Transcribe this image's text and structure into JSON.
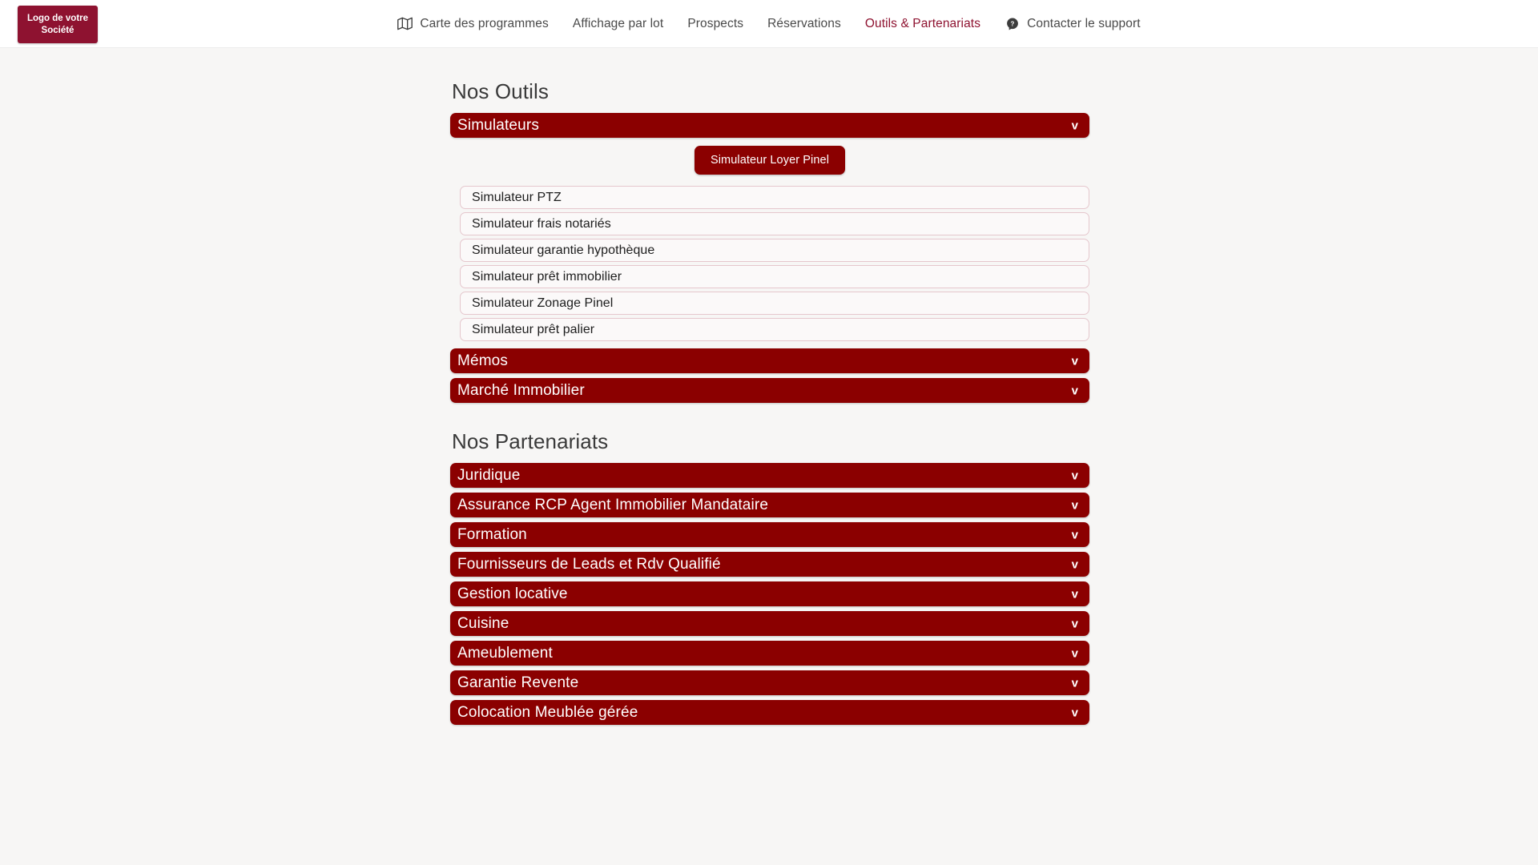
{
  "topbar": {
    "logo": {
      "line1": "Logo de votre",
      "line2": "Société"
    },
    "nav_items": [
      {
        "label": "Carte des programmes",
        "icon": "map-icon",
        "active": false
      },
      {
        "label": "Affichage par lot",
        "icon": null,
        "active": false
      },
      {
        "label": "Prospects",
        "icon": null,
        "active": false
      },
      {
        "label": "Réservations",
        "icon": null,
        "active": false
      },
      {
        "label": "Outils & Partenariats",
        "icon": null,
        "active": true
      },
      {
        "label": "Contacter le support",
        "icon": "help-circle-icon",
        "active": false
      }
    ]
  },
  "sections": [
    {
      "title": "Nos Outils",
      "groups": [
        {
          "label": "Simulateurs",
          "chevron": "v",
          "expanded": true,
          "featured_button": "Simulateur Loyer Pinel",
          "options": [
            "Simulateur PTZ",
            "Simulateur frais notariés",
            "Simulateur garantie hypothèque",
            "Simulateur prêt immobilier",
            "Simulateur Zonage Pinel",
            "Simulateur prêt palier"
          ]
        },
        {
          "label": "Mémos",
          "chevron": "v",
          "expanded": false,
          "options": []
        },
        {
          "label": "Marché Immobilier",
          "chevron": "v",
          "expanded": false,
          "options": []
        }
      ]
    },
    {
      "title": "Nos Partenariats",
      "groups": [
        {
          "label": "Juridique",
          "chevron": "v",
          "expanded": false,
          "options": []
        },
        {
          "label": "Assurance RCP Agent Immobilier Mandataire",
          "chevron": "v",
          "expanded": false,
          "options": []
        },
        {
          "label": "Formation",
          "chevron": "v",
          "expanded": false,
          "options": []
        },
        {
          "label": "Fournisseurs de Leads et Rdv Qualifié",
          "chevron": "v",
          "expanded": false,
          "options": []
        },
        {
          "label": "Gestion locative",
          "chevron": "v",
          "expanded": false,
          "options": []
        },
        {
          "label": "Cuisine",
          "chevron": "v",
          "expanded": false,
          "options": []
        },
        {
          "label": "Ameublement",
          "chevron": "v",
          "expanded": false,
          "options": []
        },
        {
          "label": "Garantie Revente",
          "chevron": "v",
          "expanded": false,
          "options": []
        },
        {
          "label": "Colocation Meublée gérée",
          "chevron": "v",
          "expanded": false,
          "options": []
        }
      ]
    }
  ],
  "colors": {
    "brand_bar": "#8b0000",
    "logo_bg": "#8e1230",
    "active_nav": "#8e1230",
    "page_bg": "#f7f6f5",
    "option_border": "#e5c7cd"
  }
}
